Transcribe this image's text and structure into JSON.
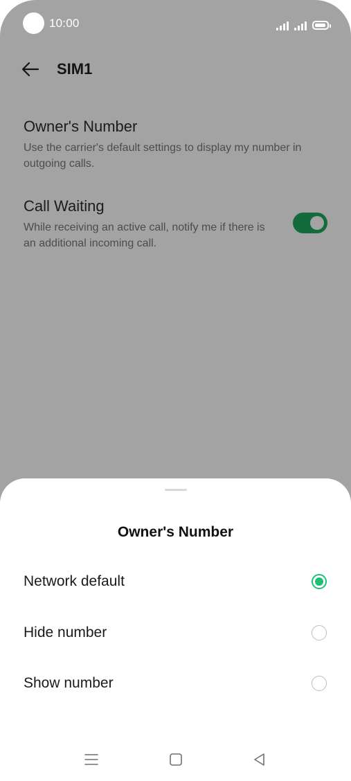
{
  "status_bar": {
    "time": "10:00"
  },
  "header": {
    "title": "SIM1",
    "back_icon": "arrow-left-icon"
  },
  "settings": {
    "owners_number": {
      "title": "Owner's Number",
      "description": "Use the carrier's default settings to display my number in outgoing calls."
    },
    "call_waiting": {
      "title": "Call Waiting",
      "description": "While receiving an active call, notify me if there is an additional incoming call.",
      "enabled": true
    }
  },
  "sheet": {
    "title": "Owner's Number",
    "options": [
      {
        "label": "Network default",
        "selected": true
      },
      {
        "label": "Hide number",
        "selected": false
      },
      {
        "label": "Show number",
        "selected": false
      }
    ]
  },
  "nav_bar": {
    "icons": [
      "menu-icon",
      "home-square-icon",
      "back-triangle-icon"
    ]
  },
  "colors": {
    "dim_overlay": "#a3a3a3",
    "toggle_on": "#136b3b",
    "radio_selected": "#1fbf75"
  }
}
